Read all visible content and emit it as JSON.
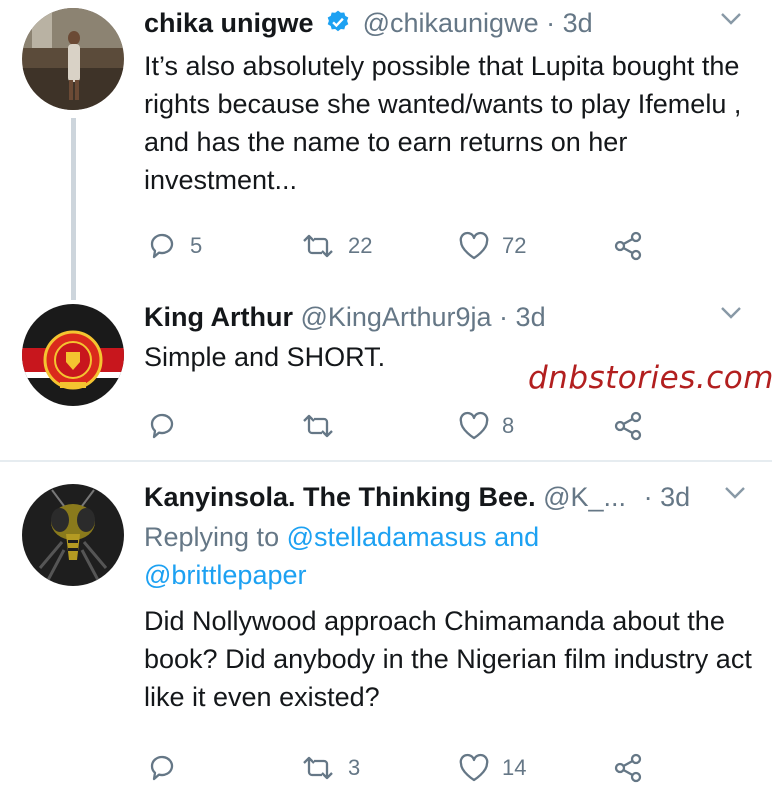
{
  "tweets": [
    {
      "name": "chika unigwe",
      "handle": "@chikaunigwe",
      "dot": "·",
      "time": "3d",
      "text": "It’s also absolutely possible that Lupita bought the rights because she wanted/wants to play Ifemelu , and has the name to earn returns on her investment...",
      "replies": "5",
      "retweets": "22",
      "likes": "72"
    },
    {
      "name": "King Arthur",
      "handle": "@KingArthur9ja",
      "dot": "·",
      "time": "3d",
      "text": "Simple and SHORT.",
      "replies": "",
      "retweets": "",
      "likes": "8"
    },
    {
      "name": "Kanyinsola. The Thinking Bee.",
      "handle": "@K_...",
      "dot": "·",
      "time": "3d",
      "reply_prefix": "Replying to",
      "reply_user1": "@stelladamasus",
      "reply_and": "and",
      "reply_user2": "@brittlepaper",
      "text": "Did Nollywood approach Chimamanda about the book? Did anybody in the Nigerian film industry act like it even existed?",
      "replies": "",
      "retweets": "3",
      "likes": "14"
    }
  ],
  "watermark": "dnbstories.com",
  "colors": {
    "text": "#14171a",
    "secondary": "#657786",
    "link": "#1da1f2",
    "verified": "#1da1f2",
    "divider": "#e6ecf0",
    "watermark": "#b21f1f"
  },
  "icons": [
    "verified-badge-icon",
    "chevron-down-icon",
    "reply-icon",
    "retweet-icon",
    "like-icon",
    "share-icon"
  ]
}
